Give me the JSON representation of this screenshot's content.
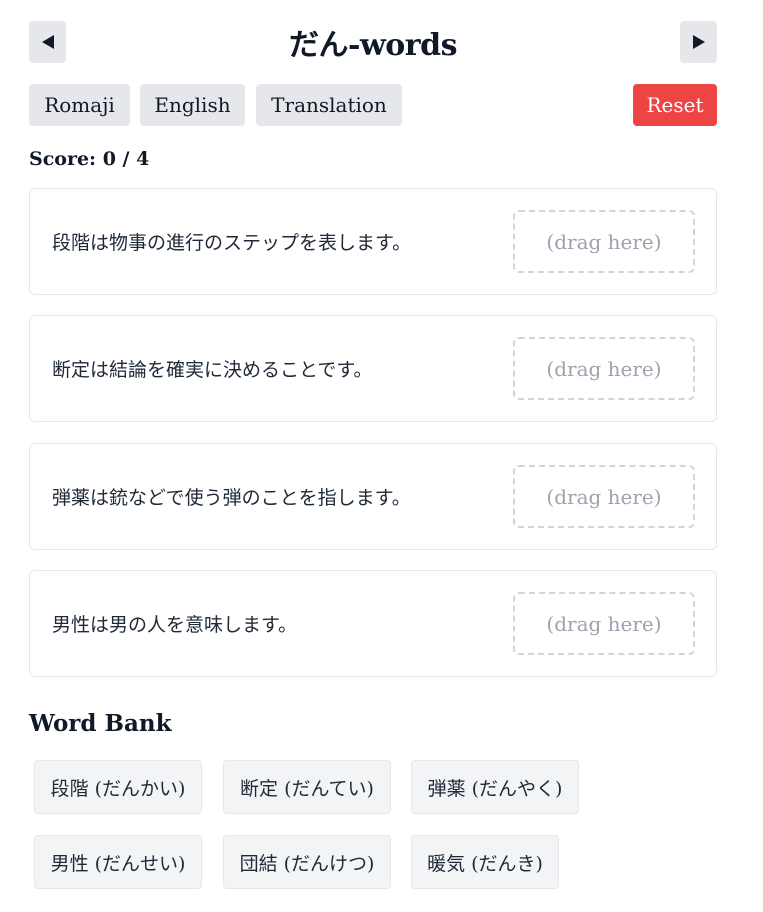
{
  "header": {
    "title": "だん-words",
    "prev_icon": "◀",
    "next_icon": "▶"
  },
  "toolbar": {
    "romaji_label": "Romaji",
    "english_label": "English",
    "translation_label": "Translation",
    "reset_label": "Reset",
    "reset_color": "#ef4444"
  },
  "score": {
    "text": "Score: 0 / 4"
  },
  "questions": [
    {
      "sentence": "段階は物事の進行のステップを表します。",
      "drop_placeholder": "(drag here)"
    },
    {
      "sentence": "断定は結論を確実に決めることです。",
      "drop_placeholder": "(drag here)"
    },
    {
      "sentence": "弾薬は銃などで使う弾のことを指します。",
      "drop_placeholder": "(drag here)"
    },
    {
      "sentence": "男性は男の人を意味します。",
      "drop_placeholder": "(drag here)"
    }
  ],
  "word_bank": {
    "title": "Word Bank",
    "words": [
      "段階 (だんかい)",
      "断定 (だんてい)",
      "弾薬 (だんやく)",
      "男性 (だんせい)",
      "団結 (だんけつ)",
      "暖気 (だんき)"
    ]
  }
}
